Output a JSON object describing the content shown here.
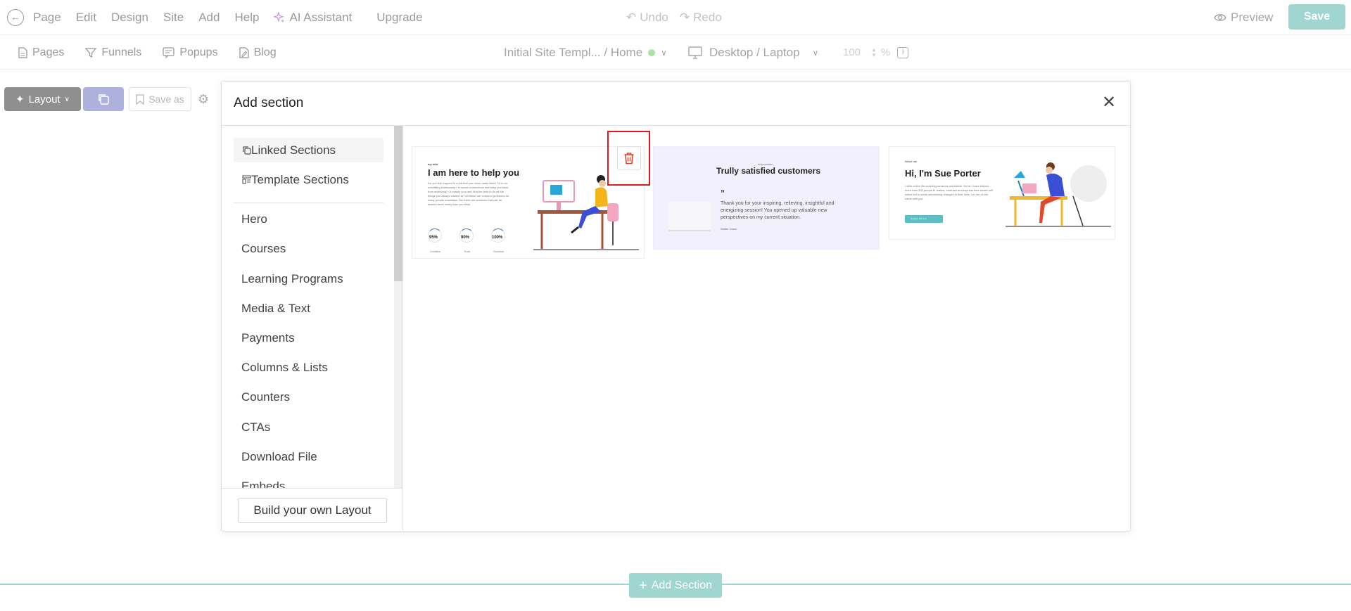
{
  "menu": {
    "items": [
      "Page",
      "Edit",
      "Design",
      "Site",
      "Add",
      "Help"
    ],
    "ai_label": "AI Assistant",
    "upgrade_label": "Upgrade",
    "undo_label": "Undo",
    "redo_label": "Redo",
    "preview_label": "Preview",
    "save_label": "Save"
  },
  "subbar": {
    "tabs": [
      "Pages",
      "Funnels",
      "Popups",
      "Blog"
    ],
    "site": "Initial Site Templ... / Home",
    "device": "Desktop / Laptop",
    "zoom_value": "100",
    "zoom_unit": "%"
  },
  "toolbar": {
    "layout_label": "Layout",
    "save_as_label": "Save as"
  },
  "modal": {
    "title": "Add section",
    "linked_sections": "Linked Sections",
    "template_sections": "Template Sections",
    "categories": [
      "Hero",
      "Courses",
      "Learning Programs",
      "Media & Text",
      "Payments",
      "Columns & Lists",
      "Counters",
      "CTAs",
      "Download File",
      "Embeds"
    ],
    "build_own_label": "Build your own Layout"
  },
  "thumbnails": [
    {
      "eyebrow": "my info",
      "title": "I am here to help you",
      "body": "Do you feel trapped in a job that you never really liked? Or in an unfulfilling relationship? In social connections that keep you back from achieving? Or simply you can't find the time to do all the things you always wanted to? All these are common problems for many people nowadays. But there are solutions that can be tackled more easily than you think.",
      "stats": [
        "95%",
        "90%",
        "100%"
      ],
      "stat_labels": [
        "Creative",
        "Trust",
        "Success"
      ]
    },
    {
      "eyebrow": "testimonials",
      "title": "Trully satisfied customers",
      "quote_mark": "”",
      "quote": "Thank you for your inspiring, relieving, insightful and energizing session! You opened up valuable new perspectives on my current situation.",
      "author": "Walter Jones"
    },
    {
      "eyebrow": "About me",
      "title": "Hi, I'm Sue Porter",
      "body": "I offer online life coaching sessions worldwide. So far I have helped more than 300 people to realize, embrace and express their innate self which led to some astonishing changes in their lives. Let me do the same with you.",
      "cta": "Register Me Now"
    }
  ],
  "bottom": {
    "add_section_label": "Add Section"
  },
  "colors": {
    "accent": "#9fd6d0",
    "delete_highlight": "#e0191e",
    "trash_icon": "#e0442a"
  }
}
